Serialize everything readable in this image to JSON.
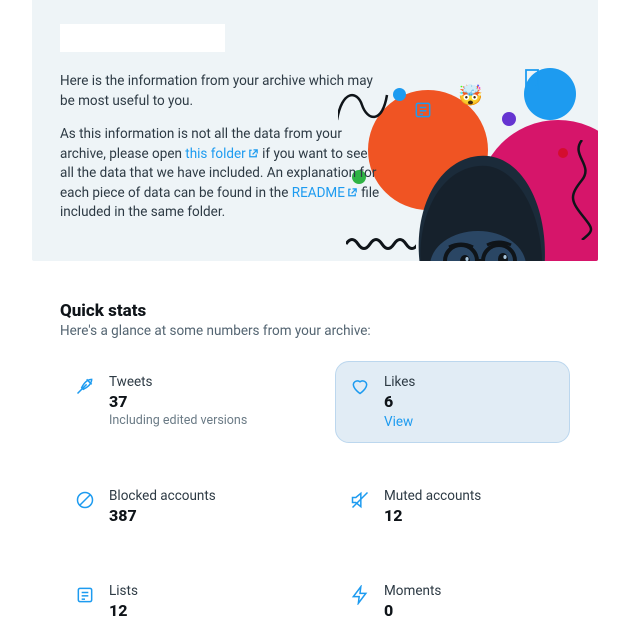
{
  "hero": {
    "intro1": "Here is the information from your archive which may be most useful to you.",
    "intro2_pre": "As this information is not all the data from your archive, please open ",
    "link1": "this folder",
    "intro2_mid": " if you want to see all the data that we have included. An explanation for each piece of data can be found in the ",
    "link2": "README",
    "intro2_post": " file included in the same folder."
  },
  "quick": {
    "title": "Quick stats",
    "subtitle": "Here's a glance at some numbers from your archive:"
  },
  "stats": {
    "tweets": {
      "label": "Tweets",
      "value": "37",
      "note": "Including edited versions"
    },
    "likes": {
      "label": "Likes",
      "value": "6",
      "link": "View"
    },
    "blocked": {
      "label": "Blocked accounts",
      "value": "387"
    },
    "muted": {
      "label": "Muted accounts",
      "value": "12"
    },
    "lists": {
      "label": "Lists",
      "value": "12"
    },
    "moments": {
      "label": "Moments",
      "value": "0"
    }
  }
}
